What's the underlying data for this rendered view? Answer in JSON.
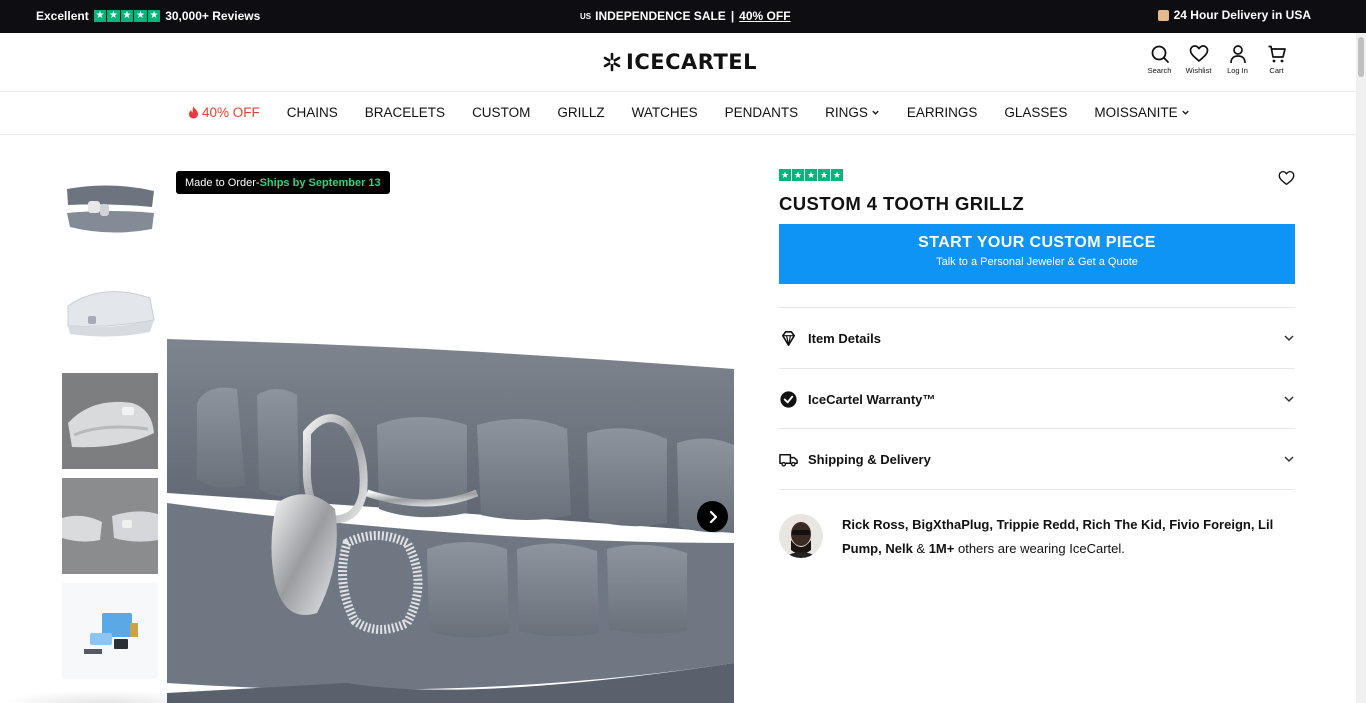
{
  "topbar": {
    "rating_word": "Excellent",
    "reviews": "30,000+ Reviews",
    "flag": "US",
    "sale_label": "INDEPENDENCE SALE",
    "separator": "|",
    "sale_discount": "40% OFF",
    "delivery": "24 Hour Delivery in USA"
  },
  "header": {
    "logo": "ICECARTEL",
    "icons": [
      {
        "label": "Search"
      },
      {
        "label": "Wishlist"
      },
      {
        "label": "Log In"
      },
      {
        "label": "Cart"
      }
    ]
  },
  "nav": {
    "items": [
      {
        "label": "40% OFF"
      },
      {
        "label": "CHAINS"
      },
      {
        "label": "BRACELETS"
      },
      {
        "label": "CUSTOM"
      },
      {
        "label": "GRILLZ"
      },
      {
        "label": "WATCHES"
      },
      {
        "label": "PENDANTS"
      },
      {
        "label": "RINGS"
      },
      {
        "label": "EARRINGS"
      },
      {
        "label": "GLASSES"
      },
      {
        "label": "MOISSANITE"
      }
    ]
  },
  "gallery": {
    "badge_prefix": "Made to Order-",
    "badge_ships": "Ships by September 13"
  },
  "product": {
    "title": "CUSTOM 4 TOOTH GRILLZ",
    "cta_title": "START YOUR CUSTOM PIECE",
    "cta_subtitle": "Talk to a Personal Jeweler & Get a Quote",
    "accordions": [
      {
        "label": "Item Details"
      },
      {
        "label": "IceCartel Warranty™"
      },
      {
        "label": "Shipping & Delivery"
      }
    ],
    "celebs_names": "Rick Ross, BigXthaPlug, Trippie Redd, Rich The Kid, Fivio Foreign, Lil Pump, Nelk",
    "celebs_amp": " & ",
    "celebs_count": "1M+",
    "celebs_tail": " others are wearing IceCartel."
  },
  "colors": {
    "accent_blue": "#0d94f5",
    "trustpilot_green": "#00b67a",
    "sale_red": "#e8402e",
    "ships_green": "#33d37a",
    "topbar_bg": "#0d0d12"
  }
}
